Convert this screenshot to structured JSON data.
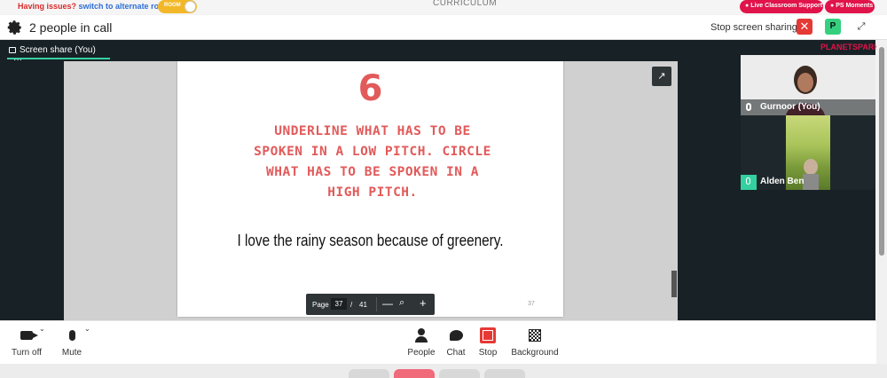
{
  "topbar": {
    "issues_text": "Having issues?",
    "alternate_link": "switch to alternate room",
    "room_toggle_label": "ROOM",
    "center_title": "CURRICULUM",
    "support_button": "Live Classroom Support",
    "moments_button": "PS Moments"
  },
  "header": {
    "people_count": "2 people in call",
    "stop_sharing_label": "Stop screen sharing",
    "close_glyph": "✕",
    "participant_initial": "P",
    "expand_glyph": "⤢"
  },
  "stage": {
    "share_tab_label": "Screen share (You)",
    "share_menu_glyph": "···",
    "popout_glyph": "↗"
  },
  "slide": {
    "number": "6",
    "instruction": "UNDERLINE WHAT HAS TO BE SPOKEN IN A LOW PITCH. CIRCLE WHAT HAS TO BE SPOKEN IN A HIGH PITCH.",
    "sentence": "I love the rainy season because of greenery.",
    "footer_page": "37"
  },
  "pager": {
    "page_label": "Page",
    "current_page": "37",
    "separator": "/",
    "total_pages": "41",
    "minus_glyph": "—",
    "zoom_glyph": "⌕",
    "plus_glyph": "+"
  },
  "participants": {
    "brand": "PLANETSPARK",
    "tiles": [
      {
        "name": "Gurnoor (You)"
      },
      {
        "name": "Alden Ben"
      }
    ]
  },
  "toolbar": {
    "camera_label": "Turn off",
    "mute_label": "Mute",
    "people_label": "People",
    "chat_label": "Chat",
    "stop_label": "Stop",
    "background_label": "Background",
    "caret_glyph": "⌄"
  },
  "colors": {
    "accent_red": "#e0134a",
    "slide_heading": "#e25a5a",
    "stage_bg": "#182226",
    "share_green": "#35d0a0"
  }
}
